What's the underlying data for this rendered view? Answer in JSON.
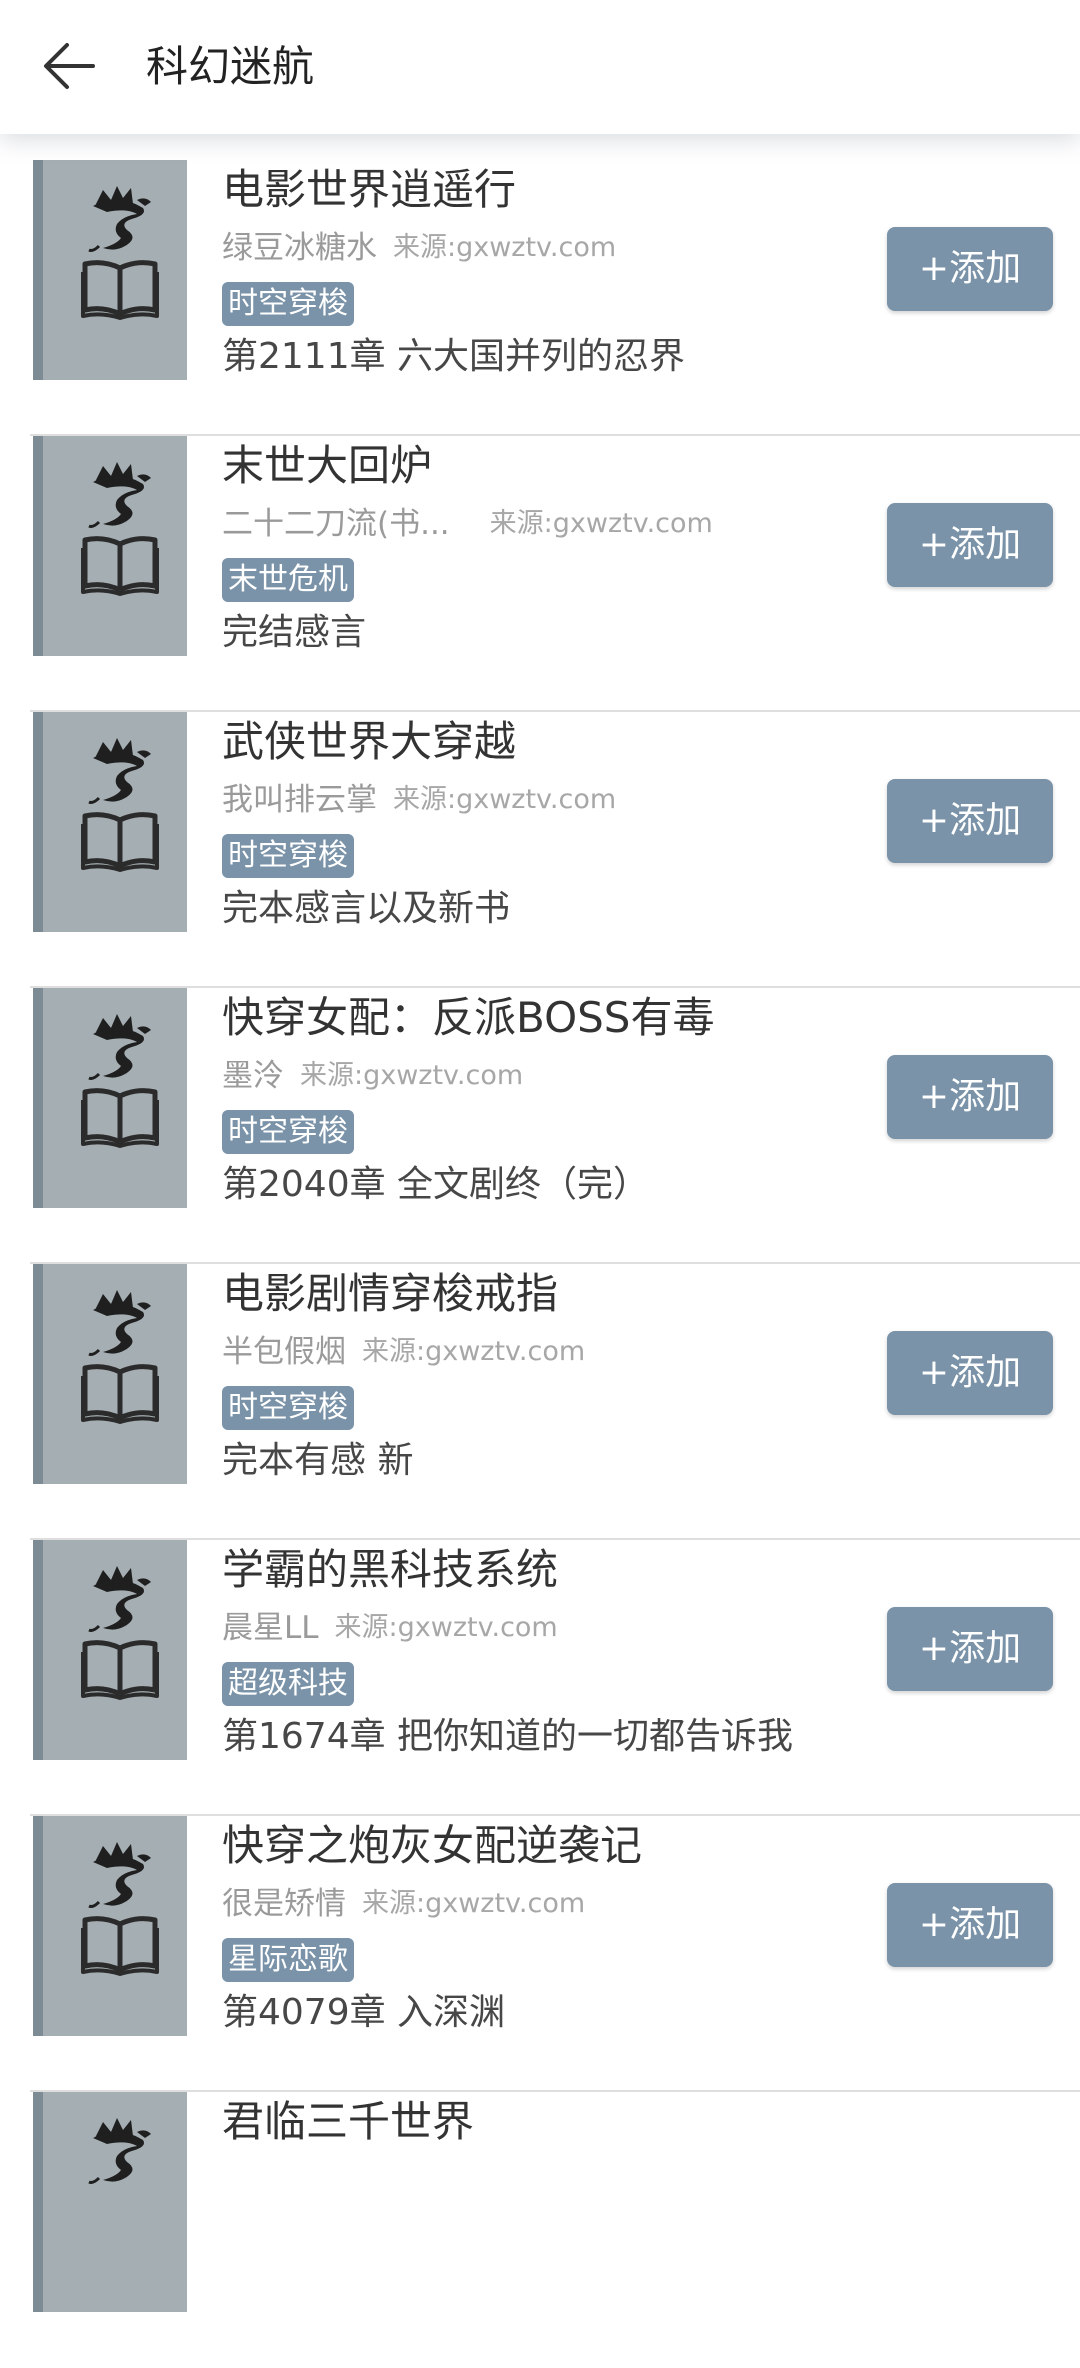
{
  "header": {
    "title": "科幻迷航"
  },
  "books": [
    {
      "title": "电影世界逍遥行",
      "author": "绿豆冰糖水",
      "source": "来源:gxwztv.com",
      "tag": "时空穿梭",
      "latest": "第2111章 六大国并列的忍界",
      "add_label": "+添加"
    },
    {
      "title": "末世大回炉",
      "author": "二十二刀流(书...",
      "source": "来源:gxwztv.com",
      "tag": "末世危机",
      "latest": "完结感言",
      "add_label": "+添加"
    },
    {
      "title": "武侠世界大穿越",
      "author": "我叫排云掌",
      "source": "来源:gxwztv.com",
      "tag": "时空穿梭",
      "latest": "完本感言以及新书",
      "add_label": "+添加"
    },
    {
      "title": "快穿女配：反派BOSS有毒",
      "author": "墨泠",
      "source": "来源:gxwztv.com",
      "tag": "时空穿梭",
      "latest": "第2040章 全文剧终（完）",
      "add_label": "+添加"
    },
    {
      "title": "电影剧情穿梭戒指",
      "author": "半包假烟",
      "source": "来源:gxwztv.com",
      "tag": "时空穿梭",
      "latest": "完本有感 新",
      "add_label": "+添加"
    },
    {
      "title": "学霸的黑科技系统",
      "author": "晨星LL",
      "source": "来源:gxwztv.com",
      "tag": "超级科技",
      "latest": "第1674章 把你知道的一切都告诉我",
      "add_label": "+添加"
    },
    {
      "title": "快穿之炮灰女配逆袭记",
      "author": "很是矫情",
      "source": "来源:gxwztv.com",
      "tag": "星际恋歌",
      "latest": "第4079章 入深渊",
      "add_label": "+添加"
    },
    {
      "title": "君临三千世界"
    }
  ],
  "icons": {
    "back": "arrow-left-icon",
    "cover_dragon": "dragon-icon",
    "cover_book": "open-book-icon"
  },
  "colors": {
    "accent": "#7a93a8",
    "cover_bg": "#a5afb3",
    "cover_spine": "#7d8c94",
    "title_text": "#333333",
    "meta_text": "#9a9a9a"
  }
}
